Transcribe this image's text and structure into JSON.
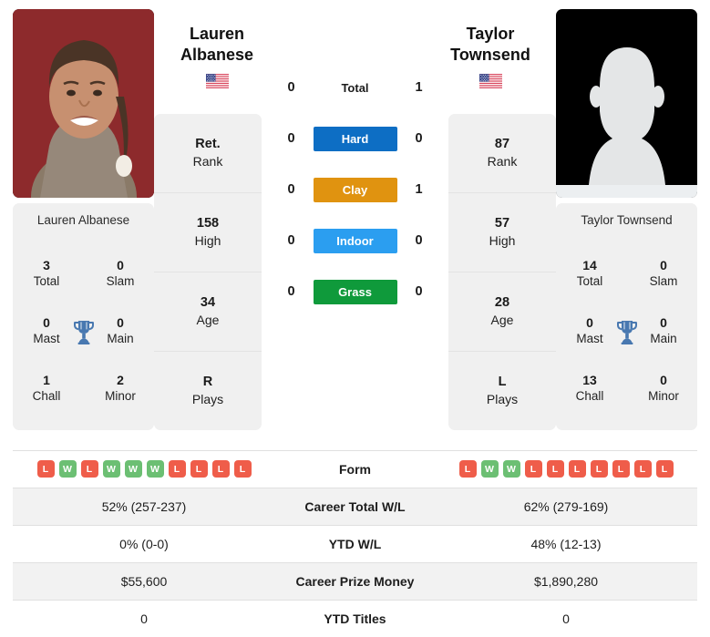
{
  "players": {
    "left": {
      "first_name": "Lauren",
      "last_name": "Albanese",
      "full_name": "Lauren Albanese",
      "flag": "us-flag-icon",
      "photo": "player-photo",
      "rank": "Ret.",
      "rank_label": "Rank",
      "high": "158",
      "high_label": "High",
      "age": "34",
      "age_label": "Age",
      "plays": "R",
      "plays_label": "Plays",
      "titles": {
        "total": "3",
        "total_label": "Total",
        "slam": "0",
        "slam_label": "Slam",
        "mast": "0",
        "mast_label": "Mast",
        "main": "0",
        "main_label": "Main",
        "chall": "1",
        "chall_label": "Chall",
        "minor": "2",
        "minor_label": "Minor"
      },
      "h2h": {
        "total": "0",
        "hard": "0",
        "clay": "0",
        "indoor": "0",
        "grass": "0"
      },
      "form": [
        "L",
        "W",
        "L",
        "W",
        "W",
        "W",
        "L",
        "L",
        "L",
        "L"
      ],
      "career_wl": "52% (257-237)",
      "ytd_wl": "0% (0-0)",
      "prize_money": "$55,600",
      "ytd_titles": "0"
    },
    "right": {
      "first_name": "Taylor",
      "last_name": "Townsend",
      "full_name": "Taylor Townsend",
      "flag": "us-flag-icon",
      "photo": "player-photo-placeholder",
      "rank": "87",
      "rank_label": "Rank",
      "high": "57",
      "high_label": "High",
      "age": "28",
      "age_label": "Age",
      "plays": "L",
      "plays_label": "Plays",
      "titles": {
        "total": "14",
        "total_label": "Total",
        "slam": "0",
        "slam_label": "Slam",
        "mast": "0",
        "mast_label": "Mast",
        "main": "0",
        "main_label": "Main",
        "chall": "13",
        "chall_label": "Chall",
        "minor": "0",
        "minor_label": "Minor"
      },
      "h2h": {
        "total": "1",
        "hard": "0",
        "clay": "1",
        "indoor": "0",
        "grass": "0"
      },
      "form": [
        "L",
        "W",
        "W",
        "L",
        "L",
        "L",
        "L",
        "L",
        "L",
        "L"
      ],
      "career_wl": "62% (279-169)",
      "ytd_wl": "48% (12-13)",
      "prize_money": "$1,890,280",
      "ytd_titles": "0"
    }
  },
  "h2h_rows": [
    {
      "key": "total",
      "label": "Total",
      "badge": false,
      "color": ""
    },
    {
      "key": "hard",
      "label": "Hard",
      "badge": true,
      "color": "#0d6ec4"
    },
    {
      "key": "clay",
      "label": "Clay",
      "badge": true,
      "color": "#e09310"
    },
    {
      "key": "indoor",
      "label": "Indoor",
      "badge": true,
      "color": "#2b9ef0"
    },
    {
      "key": "grass",
      "label": "Grass",
      "badge": true,
      "color": "#0f9a3b"
    }
  ],
  "table_rows": [
    {
      "label": "Form",
      "type": "form"
    },
    {
      "label": "Career Total W/L",
      "type": "text",
      "field": "career_wl"
    },
    {
      "label": "YTD W/L",
      "type": "text",
      "field": "ytd_wl"
    },
    {
      "label": "Career Prize Money",
      "type": "text",
      "field": "prize_money"
    },
    {
      "label": "YTD Titles",
      "type": "text",
      "field": "ytd_titles"
    }
  ],
  "colors": {
    "win": "#6cbf73",
    "loss": "#ef5d4a",
    "trophy": "#4878b0",
    "panel": "#f0f0f0",
    "row_alt": "#f2f2f2"
  }
}
